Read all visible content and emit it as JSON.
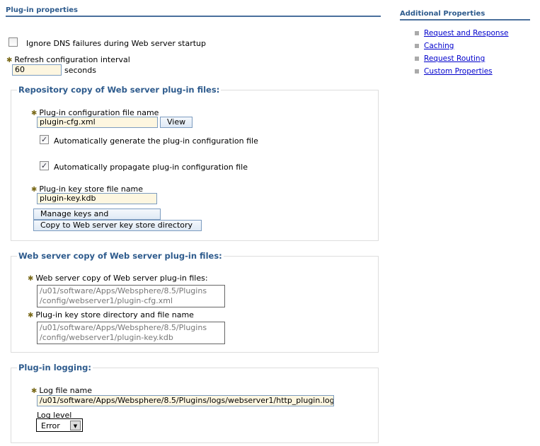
{
  "main": {
    "title": "Plug-in properties",
    "ignore_dns": {
      "label": "Ignore DNS failures during Web server startup",
      "checked": false
    },
    "refresh": {
      "label": "Refresh configuration interval",
      "value": "60",
      "unit": "seconds"
    },
    "repo": {
      "legend": "Repository copy of Web server plug-in files:",
      "cfg_label": "Plug-in configuration file name",
      "cfg_value": "plugin-cfg.xml",
      "view": "View",
      "auto_gen": {
        "label": "Automatically generate the plug-in configuration file",
        "checked": true
      },
      "auto_prop": {
        "label": "Automatically propagate plug-in configuration file",
        "checked": true
      },
      "key_label": "Plug-in key store file name",
      "key_value": "plugin-key.kdb",
      "manage": "Manage keys and certificates",
      "copy": "Copy to Web server key store directory"
    },
    "webcopy": {
      "legend": "Web server copy of Web server plug-in files:",
      "files_label": "Web server copy of Web server plug-in files:",
      "files_value": [
        "/u01/software/Apps/Websphere/8.5/Plugins",
        "/config/webserver1/plugin-cfg.xml"
      ],
      "key_label": "Plug-in key store directory and file name",
      "key_value": [
        "/u01/software/Apps/Websphere/8.5/Plugins",
        "/config/webserver1/plugin-key.kdb"
      ]
    },
    "logging": {
      "legend": "Plug-in logging:",
      "log_label": "Log file name",
      "log_value": "/u01/software/Apps/Websphere/8.5/Plugins/logs/webserver1/http_plugin.log",
      "level_label": "Log level",
      "level_value": "Error"
    }
  },
  "side": {
    "title": "Additional Properties",
    "links": [
      "Request and Response",
      "Caching",
      "Request Routing",
      "Custom Properties"
    ]
  }
}
